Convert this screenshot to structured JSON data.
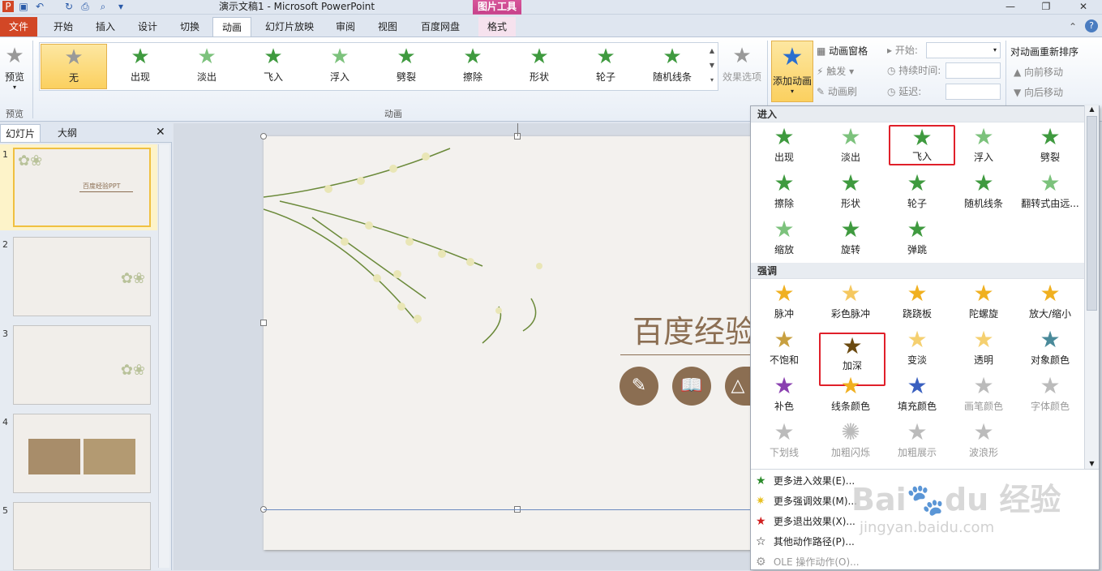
{
  "window": {
    "title": "演示文稿1 - Microsoft PowerPoint",
    "context_tab": "图片工具",
    "context_subtab": "格式"
  },
  "tabs": [
    "文件",
    "开始",
    "插入",
    "设计",
    "切换",
    "动画",
    "幻灯片放映",
    "审阅",
    "视图",
    "百度网盘"
  ],
  "ribbon": {
    "preview": {
      "label": "预览",
      "group": "预览"
    },
    "animations": [
      "无",
      "出现",
      "淡出",
      "飞入",
      "浮入",
      "劈裂",
      "擦除",
      "形状",
      "轮子",
      "随机线条"
    ],
    "effect_options": "效果选项",
    "group_animation": "动画",
    "add_animation": "添加动画",
    "pane": "动画窗格",
    "trigger": "触发",
    "painter": "动画刷",
    "start": "开始:",
    "duration": "持续时间:",
    "delay": "延迟:",
    "reorder": "对动画重新排序",
    "move_earlier": "向前移动",
    "move_later": "向后移动"
  },
  "left_panel": {
    "tabs": [
      "幻灯片",
      "大纲"
    ],
    "slides": [
      "1",
      "2",
      "3",
      "4",
      "5"
    ]
  },
  "slide": {
    "title": "百度经验"
  },
  "dropdown": {
    "entrance_header": "进入",
    "entrance": [
      "出现",
      "淡出",
      "飞入",
      "浮入",
      "劈裂",
      "擦除",
      "形状",
      "轮子",
      "随机线条",
      "翻转式由远...",
      "缩放",
      "旋转",
      "弹跳"
    ],
    "emphasis_header": "强调",
    "emphasis": [
      "脉冲",
      "彩色脉冲",
      "跷跷板",
      "陀螺旋",
      "放大/缩小",
      "不饱和",
      "加深",
      "变淡",
      "透明",
      "对象颜色",
      "补色",
      "线条颜色",
      "填充颜色",
      "画笔颜色",
      "字体颜色",
      "下划线",
      "加粗闪烁",
      "加粗展示",
      "波浪形"
    ],
    "more": [
      "更多进入效果(E)...",
      "更多强调效果(M)...",
      "更多退出效果(X)...",
      "其他动作路径(P)...",
      "OLE 操作动作(O)..."
    ]
  },
  "colors": {
    "accent_file": "#d24726",
    "context": "#c7418a",
    "highlight": "#e0202a",
    "brown": "#8b6e52"
  }
}
